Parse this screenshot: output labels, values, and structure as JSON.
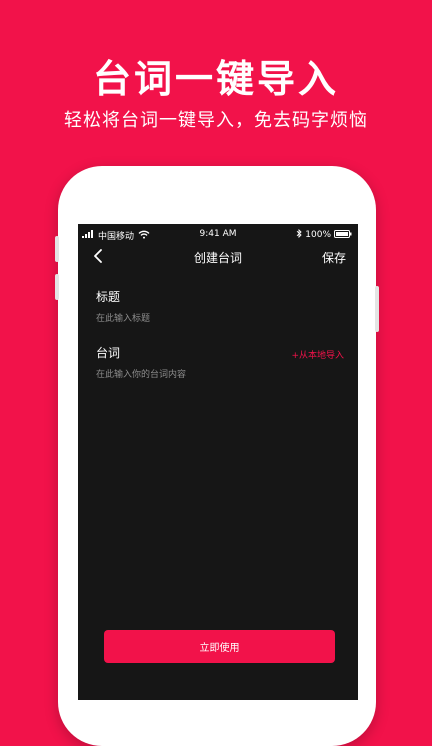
{
  "banner": {
    "headline": "台词一键导入",
    "subline": "轻松将台词一键导入，免去码字烦恼"
  },
  "status_bar": {
    "carrier": "中国移动",
    "time": "9:41 AM",
    "battery": "100%"
  },
  "nav": {
    "title": "创建台词",
    "save_label": "保存"
  },
  "form": {
    "title_label": "标题",
    "title_placeholder": "在此输入标题",
    "script_label": "台词",
    "script_placeholder": "在此输入你的台词内容",
    "import_link": "+从本地导入"
  },
  "primary_button": {
    "label": "立即使用"
  },
  "colors": {
    "brand": "#f2124a",
    "screen_bg": "#161616"
  }
}
